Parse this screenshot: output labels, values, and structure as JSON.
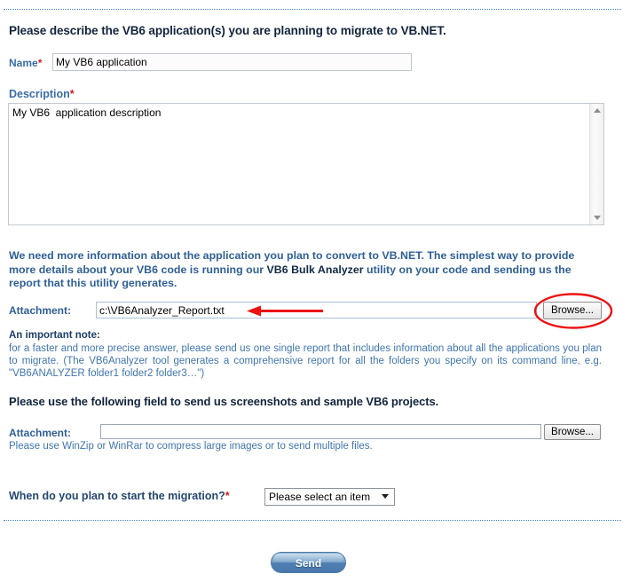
{
  "page": {
    "heading_main": "Please describe the VB6 application(s) you are planning to migrate to VB.NET.",
    "heading_screenshots": "Please use the following field to send us screenshots and sample VB6 projects."
  },
  "form": {
    "name": {
      "label": "Name",
      "required_mark": "*",
      "value": "My VB6 application",
      "placeholder": ""
    },
    "description": {
      "label": "Description",
      "required_mark": "*",
      "value": "My VB6  application description",
      "placeholder": ""
    },
    "info_paragraph": {
      "part1": "We need more information about the application you plan to convert to VB.NET. The simplest way to provide more details about your VB6 code is running our ",
      "bold": "VB6 Bulk Analyzer",
      "part2": " utility on your code and sending us the report that this utility generates."
    },
    "attachment_report": {
      "label": "Attachment:",
      "value": "c:\\VB6Analyzer_Report.txt",
      "placeholder": "",
      "browse_label": "Browse..."
    },
    "note": {
      "title": "An important note:",
      "body": "for a faster and more precise answer, please send us one single report that includes information about all the applications you plan to migrate. (The VB6Analyzer tool generates a comprehensive report for all the folders you specify on its command line, e.g. \"VB6ANALYZER folder1 folder2 folder3…\")"
    },
    "attachment_screenshots": {
      "label": "Attachment:",
      "value": "",
      "placeholder": "",
      "browse_label": "Browse...",
      "hint": "Please use WinZip or WinRar to compress large images or to send multiple files."
    },
    "migration_start": {
      "label": "When do you plan to start the migration?",
      "required_mark": "*",
      "selected": "Please select an item",
      "options": [
        "Please select an item"
      ]
    },
    "submit": {
      "label": "Send"
    }
  },
  "annotations": {
    "arrow_color": "#ee1111",
    "ellipse_color": "#ee1111",
    "arrow_target": "attachment-report-input",
    "ellipse_target": "browse-button-report"
  },
  "colors": {
    "label_blue": "#3a6ea5",
    "heading_navy": "#12243b",
    "body_blue": "#4076ad",
    "rule_blue": "#3f86c8",
    "required_red": "#cc2222",
    "send_blue": "#4f7fb2"
  }
}
